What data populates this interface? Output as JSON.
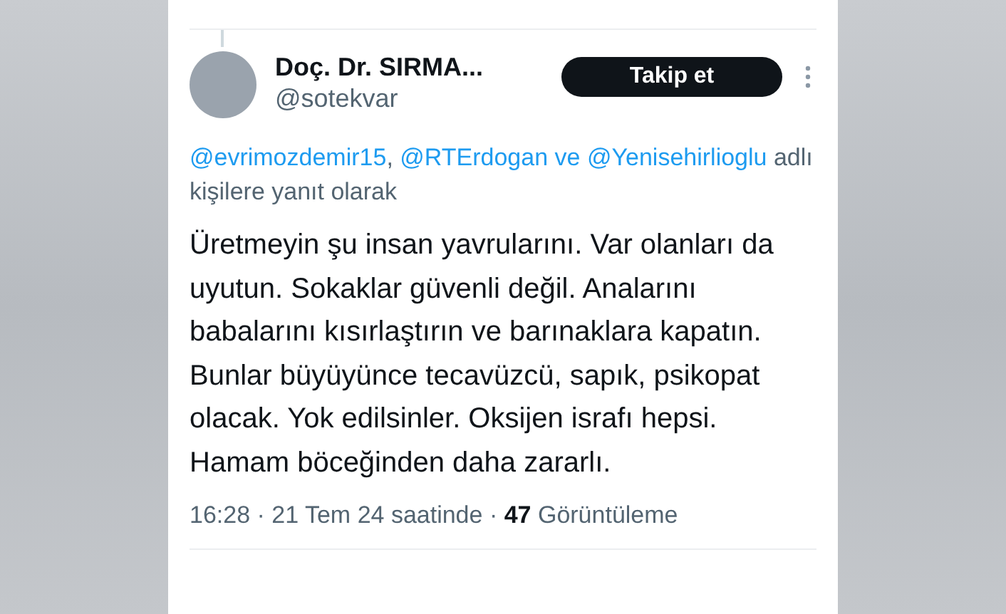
{
  "tweet": {
    "author": {
      "name": "Doç. Dr. SIRMA...",
      "handle": "@sotekvar"
    },
    "follow_button": {
      "label": "Takip et"
    },
    "reply_context": [
      {
        "kind": "mention",
        "text": "@evrimozdemir15"
      },
      {
        "kind": "plain",
        "text": ", "
      },
      {
        "kind": "mention",
        "text": "@RTErdogan"
      },
      {
        "kind": "mention",
        "text": "ve"
      },
      {
        "kind": "mention",
        "text": "@Yenisehirlioglu"
      },
      {
        "kind": "plain",
        "text": " adlı kişilere yanıt olarak"
      }
    ],
    "text": "Üretmeyin şu insan yavrularını. Var olanları da uyutun. Sokaklar güvenli değil. Analarını babalarını kısırlaştırın ve barınaklara kapatın. Bunlar büyüyünce tecavüzcü, sapık, psikopat olacak. Yok edilsinler. Oksijen israfı hepsi. Hamam böceğinden daha zararlı.",
    "meta": "16:28 · 21 Tem 24 saatinde · **47** Görüntüleme"
  }
}
